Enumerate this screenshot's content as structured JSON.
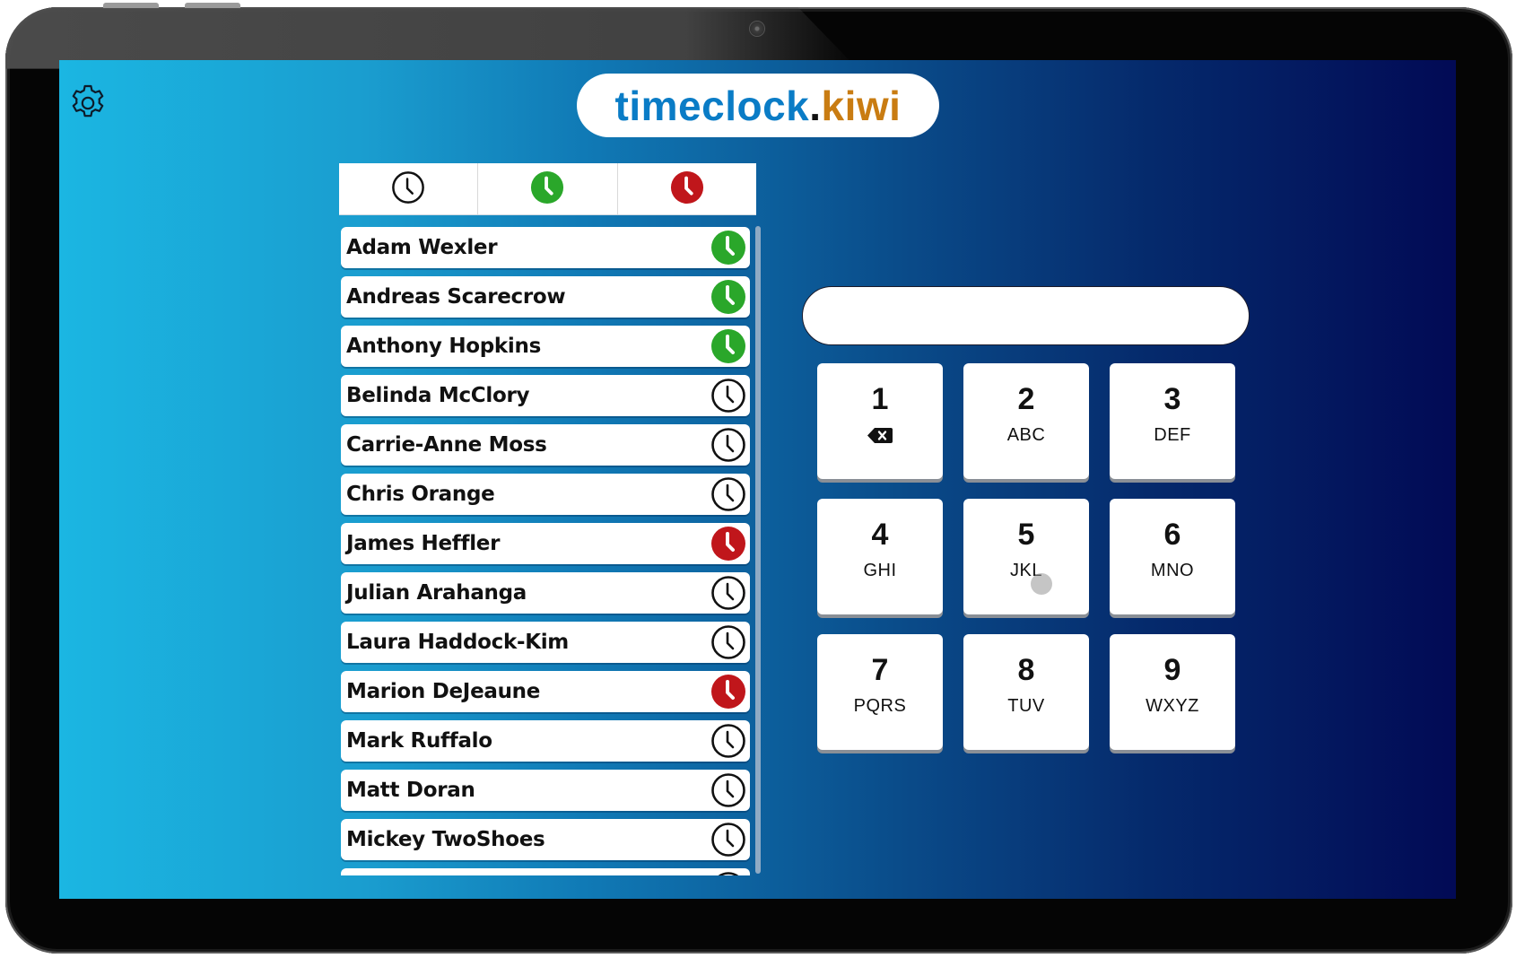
{
  "device": {
    "type": "tablet",
    "camera_icon": "camera-dot-icon"
  },
  "app": {
    "settings_icon": "gear-icon",
    "logo": {
      "part1": "timeclock",
      "dot": ".",
      "part2": "kiwi"
    }
  },
  "colors": {
    "logo_blue": "#0a7cc6",
    "logo_orange": "#c97c12",
    "clocked_in": "#2aa72a",
    "clocked_out": "#c0161b",
    "neutral": "#111111",
    "background_left": "#1bb6e2",
    "background_right": "#020a55"
  },
  "filters": [
    {
      "id": "all",
      "icon": "clock-outline-icon",
      "status": "all"
    },
    {
      "id": "in",
      "icon": "clock-green-icon",
      "status": "in"
    },
    {
      "id": "out",
      "icon": "clock-red-icon",
      "status": "out"
    }
  ],
  "employees": [
    {
      "name": "Adam Wexler",
      "status": "in"
    },
    {
      "name": "Andreas Scarecrow",
      "status": "in"
    },
    {
      "name": "Anthony Hopkins",
      "status": "in"
    },
    {
      "name": "Belinda McClory",
      "status": "none"
    },
    {
      "name": "Carrie-Anne Moss",
      "status": "none"
    },
    {
      "name": "Chris Orange",
      "status": "none"
    },
    {
      "name": "James Heffler",
      "status": "out"
    },
    {
      "name": "Julian Arahanga",
      "status": "none"
    },
    {
      "name": "Laura Haddock-Kim",
      "status": "none"
    },
    {
      "name": "Marion DeJeaune",
      "status": "out"
    },
    {
      "name": "Mark Ruffalo",
      "status": "none"
    },
    {
      "name": "Matt Doran",
      "status": "none"
    },
    {
      "name": "Mickey TwoShoes",
      "status": "none"
    },
    {
      "name": "",
      "status": "none"
    }
  ],
  "pin_input": {
    "value": "",
    "placeholder": ""
  },
  "keypad": [
    {
      "digit": "1",
      "sub": "",
      "sub_icon": "backspace-icon"
    },
    {
      "digit": "2",
      "sub": "ABC"
    },
    {
      "digit": "3",
      "sub": "DEF"
    },
    {
      "digit": "4",
      "sub": "GHI"
    },
    {
      "digit": "5",
      "sub": "JKL",
      "touched": true
    },
    {
      "digit": "6",
      "sub": "MNO"
    },
    {
      "digit": "7",
      "sub": "PQRS"
    },
    {
      "digit": "8",
      "sub": "TUV"
    },
    {
      "digit": "9",
      "sub": "WXYZ"
    }
  ]
}
